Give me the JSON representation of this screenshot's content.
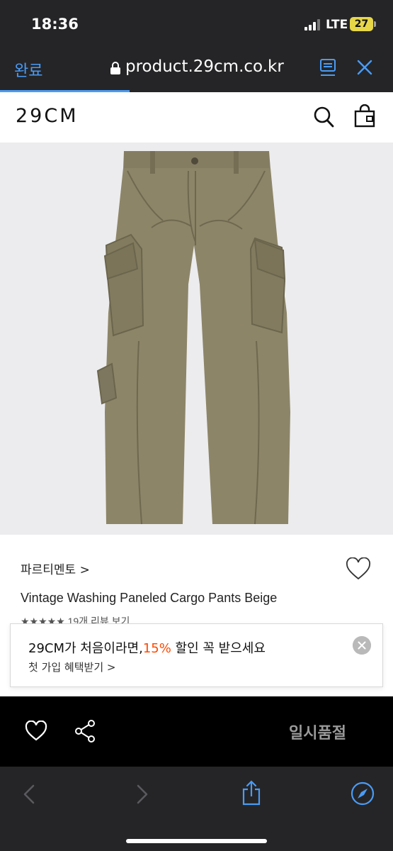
{
  "status_bar": {
    "time": "18:36",
    "network": "LTE",
    "battery": "27"
  },
  "browser": {
    "done_label": "완료",
    "url": "product.29cm.co.kr",
    "load_progress_fraction": 0.33
  },
  "site": {
    "logo": "29CM"
  },
  "product": {
    "brand": "파르티멘토 >",
    "name": "Vintage Washing Paneled Cargo Pants Beige",
    "rating_text": "★★★★★ 19개 리뷰 보기"
  },
  "promo": {
    "title_prefix": "29CM가 처음이라면,",
    "title_accent": "15%",
    "title_suffix": " 할인 꼭 받으세요",
    "subtitle": "첫 가입 혜택받기 >"
  },
  "action_bar": {
    "soldout_label": "일시품절"
  },
  "colors": {
    "accent_blue": "#4a9bf5",
    "promo_accent": "#ff4800",
    "battery": "#e7d748",
    "pants": "#8d8568"
  },
  "icons": [
    "lock-icon",
    "reader-icon",
    "close-icon",
    "search-icon",
    "shopping-bag-icon",
    "heart-outline-icon",
    "promo-close-icon",
    "heart-icon",
    "share-icon",
    "back-arrow-icon",
    "forward-arrow-icon",
    "share-box-icon",
    "compass-icon"
  ]
}
